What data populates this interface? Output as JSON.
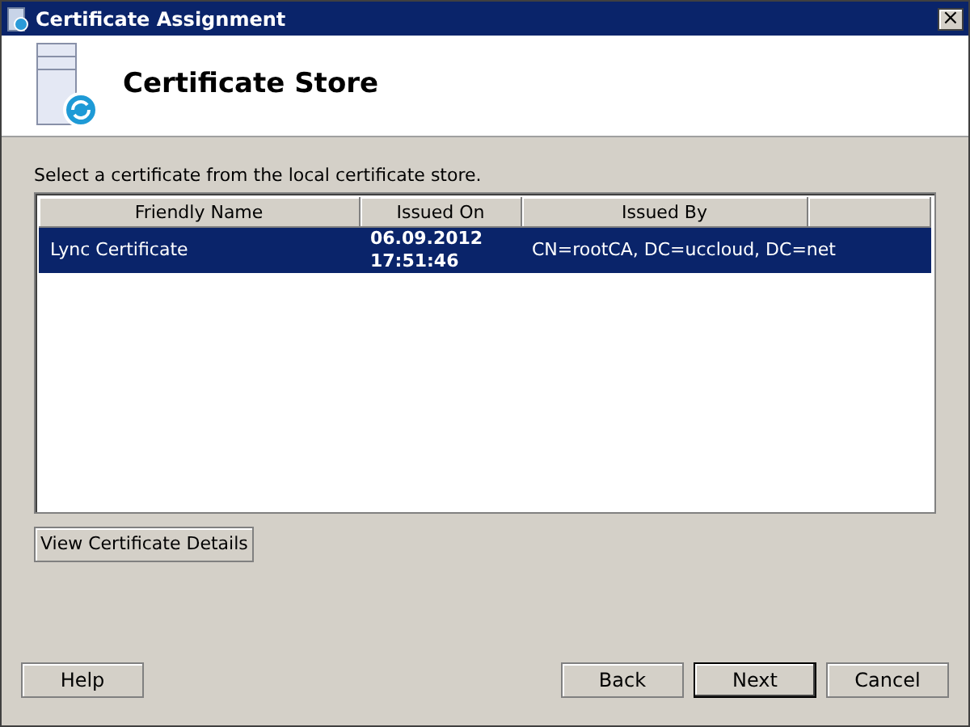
{
  "window": {
    "title": "Certificate Assignment",
    "close_label": "×"
  },
  "header": {
    "title": "Certificate Store"
  },
  "instruction": "Select a certificate from the local certificate store.",
  "table": {
    "columns": [
      "Friendly Name",
      "Issued On",
      "Issued By"
    ],
    "rows": [
      {
        "selected": true,
        "cells": [
          "Lync Certificate",
          "06.09.2012\n17:51:46",
          "CN=rootCA, DC=uccloud, DC=net"
        ]
      }
    ]
  },
  "details_button": "View Certificate Details",
  "buttons": [
    {
      "label": "Help",
      "default": false
    },
    {
      "label": "Back",
      "default": false
    },
    {
      "label": "Next",
      "default": true
    },
    {
      "label": "Cancel",
      "default": false
    }
  ]
}
